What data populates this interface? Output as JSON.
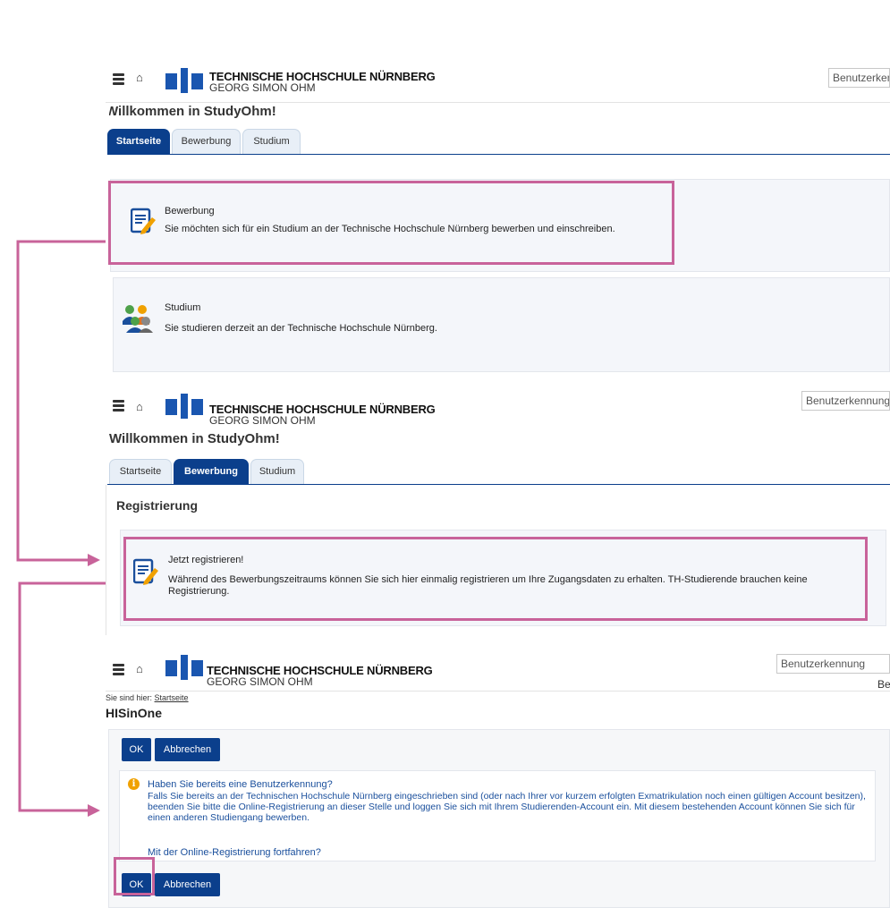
{
  "header": {
    "logo_line1": "TECHNISCHE HOCHSCHULE NÜRNBERG",
    "logo_line2": "GEORG SIMON OHM",
    "user_field_placeholder": "Benutzerkennung"
  },
  "panel1": {
    "welcome": "Willkommen in StudyOhm!",
    "tabs": [
      "Startseite",
      "Bewerbung",
      "Studium"
    ],
    "active_tab": "Startseite",
    "cards": [
      {
        "title": "Bewerbung",
        "desc": "Sie möchten sich für ein Studium an der Technische Hochschule Nürnberg bewerben und einschreiben.",
        "icon": "application-document-icon"
      },
      {
        "title": "Studium",
        "desc": "Sie studieren derzeit an der Technische Hochschule Nürnberg.",
        "icon": "students-group-icon"
      }
    ]
  },
  "panel2": {
    "welcome": "Willkommen in StudyOhm!",
    "tabs": [
      "Startseite",
      "Bewerbung",
      "Studium"
    ],
    "active_tab": "Bewerbung",
    "section_title": "Registrierung",
    "card": {
      "title": "Jetzt registrieren!",
      "desc": "Während des Bewerbungszeitraums können Sie sich hier einmalig registrieren um Ihre Zugangsdaten zu erhalten. TH-Studierende brauchen keine Registrierung."
    }
  },
  "panel3": {
    "breadcrumb_label": "Sie sind hier:",
    "breadcrumb_link": "Startseite",
    "page_title": "HISinOne",
    "top_right_partial": "Be",
    "ok_label": "OK",
    "cancel_label": "Abbrechen",
    "info_title": "Haben Sie bereits eine Benutzerkennung?",
    "info_desc": "Falls Sie bereits an der Technischen Hochschule Nürnberg eingeschrieben sind (oder nach Ihrer vor kurzem erfolgten Exmatrikulation noch einen gültigen Account besitzen), beenden Sie bitte die Online-Registrierung an dieser Stelle und loggen Sie sich mit Ihrem Studierenden-Account ein. Mit diesem bestehenden Account können Sie sich für einen anderen Studiengang bewerben.",
    "info_link": "Mit der Online-Registrierung fortfahren?"
  },
  "colors": {
    "accent": "#0b3f8c",
    "highlight": "#c8639a",
    "info": "#f0a100",
    "link": "#1a4f9c"
  }
}
